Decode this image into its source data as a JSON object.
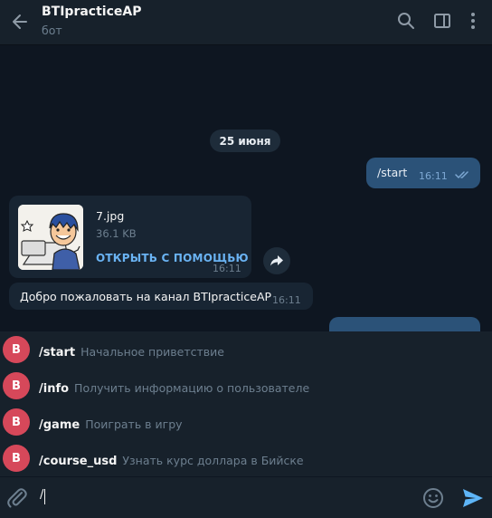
{
  "header": {
    "title": "BTIpracticeAP",
    "subtitle": "бот"
  },
  "chat": {
    "date": "25 июня",
    "outgoing": [
      {
        "text": "/start",
        "time": "16:11"
      }
    ],
    "file_message": {
      "filename": "7.jpg",
      "size": "36.1 KB",
      "open_label": "ОТКРЫТЬ С ПОМОЩЬЮ",
      "time": "16:11"
    },
    "welcome_message": {
      "text": "Добро пожаловать на канал BTIpracticeAP",
      "time": "16:11"
    }
  },
  "commands": [
    {
      "avatar": "B",
      "name": "/start",
      "desc": "Начальное приветствие"
    },
    {
      "avatar": "B",
      "name": "/info",
      "desc": "Получить информацию о пользователе"
    },
    {
      "avatar": "B",
      "name": "/game",
      "desc": "Поиграть в игру"
    },
    {
      "avatar": "B",
      "name": "/course_usd",
      "desc": "Узнать курс доллара в Бийске"
    }
  ],
  "composer": {
    "value": "/"
  },
  "colors": {
    "background": "#0e1621",
    "panel": "#17212b",
    "outgoing_bubble": "#2b5278",
    "incoming_bubble": "#182533",
    "link": "#6ab3f3",
    "avatar": "#d6485a",
    "send": "#5eb5f7"
  },
  "icons": [
    "back-arrow-icon",
    "search-icon",
    "sidebar-panel-icon",
    "more-vertical-icon",
    "double-check-icon",
    "share-icon",
    "paperclip-icon",
    "emoji-icon",
    "send-icon"
  ]
}
